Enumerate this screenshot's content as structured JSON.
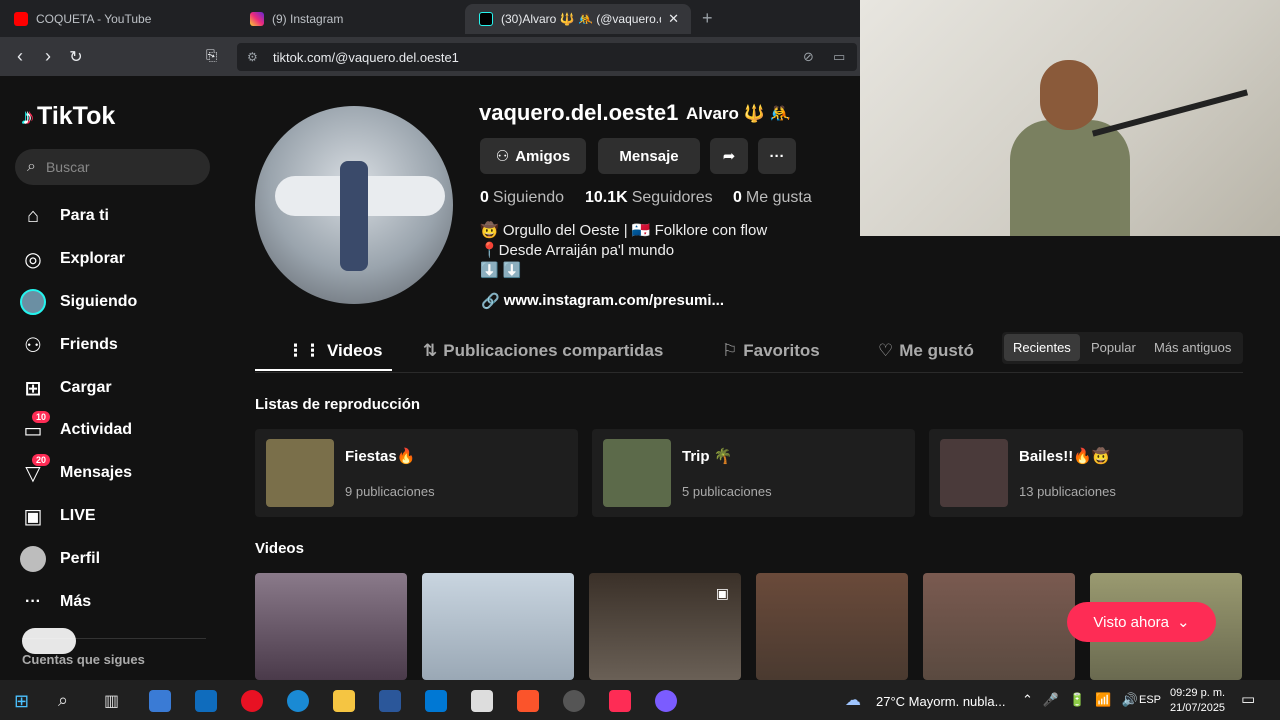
{
  "browser": {
    "tabs": [
      {
        "title": "COQUETA - YouTube",
        "color": "#ff0000"
      },
      {
        "title": "(9) Instagram",
        "color": "#d62976"
      },
      {
        "title": "(30)Alvaro 🔱 🤼 (@vaquero.del.",
        "color": "#000000"
      }
    ],
    "url": "tiktok.com/@vaquero.del.oeste1"
  },
  "sidebar": {
    "logo": "TikTok",
    "search_placeholder": "Buscar",
    "items": [
      {
        "label": "Para ti",
        "icon": "home-icon",
        "glyph": "⌂"
      },
      {
        "label": "Explorar",
        "icon": "compass-icon",
        "glyph": "◎"
      },
      {
        "label": "Siguiendo",
        "icon": "following-avatar-icon",
        "glyph": "●"
      },
      {
        "label": "Friends",
        "icon": "friends-icon",
        "glyph": "👥"
      },
      {
        "label": "Cargar",
        "icon": "upload-icon",
        "glyph": "⊞"
      },
      {
        "label": "Actividad",
        "icon": "activity-icon",
        "glyph": "▭",
        "badge": "10"
      },
      {
        "label": "Mensajes",
        "icon": "messages-icon",
        "glyph": "▽",
        "badge": "20"
      },
      {
        "label": "LIVE",
        "icon": "live-icon",
        "glyph": "▣"
      },
      {
        "label": "Perfil",
        "icon": "profile-avatar-icon",
        "glyph": "●"
      },
      {
        "label": "Más",
        "icon": "more-icon",
        "glyph": "···"
      }
    ],
    "footer": "Cuentas que sigues"
  },
  "profile": {
    "username": "vaquero.del.oeste1",
    "display_name": "Alvaro 🔱 🤼",
    "btn_friends": "Amigos",
    "btn_message": "Mensaje",
    "stats": [
      {
        "value": "0",
        "label": "Siguiendo"
      },
      {
        "value": "10.1K",
        "label": "Seguidores"
      },
      {
        "value": "0",
        "label": "Me gusta"
      }
    ],
    "bio": [
      "🤠 Orgullo del Oeste | 🇵🇦 Folklore con flow",
      "📍Desde Arraiján pa'l mundo",
      "⬇️ ⬇️"
    ],
    "link": "www.instagram.com/presumi..."
  },
  "tabs": [
    {
      "label": "Videos",
      "icon": "grid-icon"
    },
    {
      "label": "Publicaciones compartidas",
      "icon": "repost-icon"
    },
    {
      "label": "Favoritos",
      "icon": "bookmark-icon"
    },
    {
      "label": "Me gustó",
      "icon": "liked-icon"
    }
  ],
  "sort": [
    "Recientes",
    "Popular",
    "Más antiguos"
  ],
  "playlists_title": "Listas de reproducción",
  "playlists": [
    {
      "title": "Fiestas🔥",
      "count": "9 publicaciones",
      "color": "#7a6f4a"
    },
    {
      "title": "Trip 🌴",
      "count": "5 publicaciones",
      "color": "#5c6a4a"
    },
    {
      "title": "Bailes!!🔥🤠",
      "count": "13 publicaciones",
      "color": "#4a3a3a"
    }
  ],
  "videos_title": "Videos",
  "video_colors": [
    "#6a5a6a",
    "#b9c6d3",
    "#4a4036",
    "#5a4a40",
    "#6a5a50",
    "#7a7a60"
  ],
  "visto_ahora": "Visto ahora",
  "taskbar": {
    "weather": "27°C  Mayorm. nubla...",
    "lang": "ESP",
    "time": "09:29 p. m.",
    "date": "21/07/2025"
  }
}
